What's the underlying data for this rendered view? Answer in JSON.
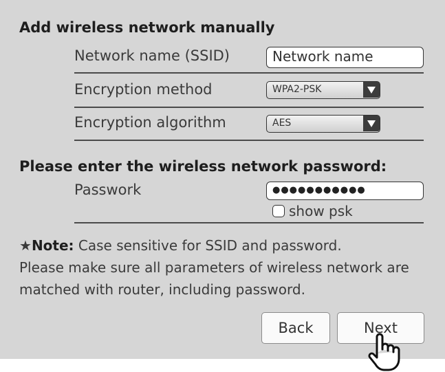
{
  "section1": {
    "title": "Add wireless network manually"
  },
  "ssid": {
    "label": "Network name (SSID)",
    "value": "Network name"
  },
  "encryption_method": {
    "label": "Encryption method",
    "selected": "WPA2-PSK"
  },
  "encryption_algorithm": {
    "label": "Encryption algorithm",
    "selected": "AES"
  },
  "section2": {
    "title": "Please enter the wireless network password:"
  },
  "password": {
    "label": "Passwork",
    "value": "●●●●●●●●●●●",
    "show_psk_label": "show psk"
  },
  "note": {
    "star": "★",
    "prefix": "Note:",
    "line1": " Case sensitive for SSID and password.",
    "line2": "Please make sure all parameters of wireless network are",
    "line3": "matched with router, including password."
  },
  "buttons": {
    "back": "Back",
    "next": "Next"
  },
  "icons": {
    "dropdown": "chevron-down-icon",
    "cursor": "hand-pointer-icon"
  },
  "colors": {
    "panel_bg": "#d6d6d6",
    "text": "#3a3a3a"
  }
}
